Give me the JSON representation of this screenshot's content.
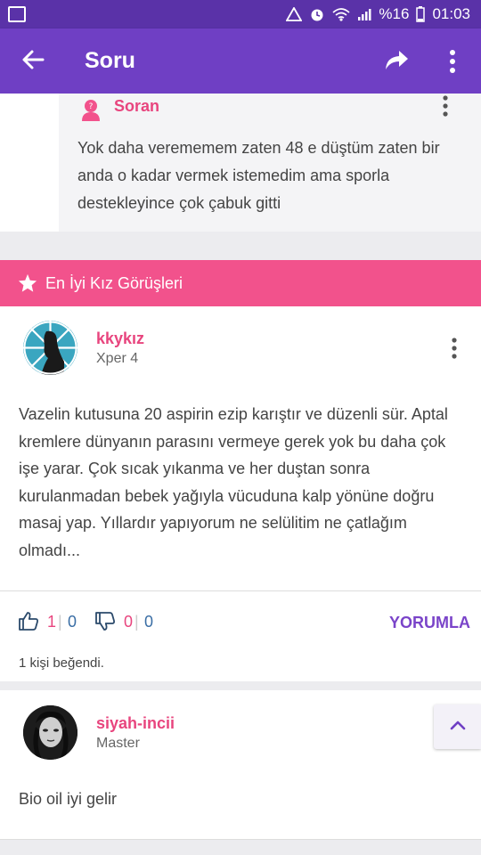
{
  "status_bar": {
    "battery_text": "%16",
    "time": "01:03"
  },
  "app_bar": {
    "title": "Soru",
    "back_icon": "arrow-left-icon",
    "share_icon": "share-icon",
    "more_icon": "more-vertical-icon"
  },
  "question": {
    "author_label": "Soran",
    "text": "Yok daha verememem zaten 48 e düştüm zaten bir anda o kadar vermek istemedim ama sporla destekleyince çok çabuk gitti"
  },
  "best_section": {
    "label": "En İyi Kız Görüşleri"
  },
  "answers": [
    {
      "username": "kkykız",
      "level": "Xper 4",
      "text": "Vazelin kutusuna 20 aspirin ezip karıştır ve düzenli sür. Aptal kremlere dünyanın parasını vermeye gerek yok bu daha çok işe yarar. Çok sıcak yıkanma ve her duştan sonra kurulanmadan bebek yağıyla vücuduna kalp yönüne doğru masaj yap. Yıllardır yapıyorum ne selülitim ne çatlağım olmadı...",
      "likes": "1",
      "likes_neutral": "0",
      "dislikes": "0",
      "dislikes_neutral": "0",
      "comment_label": "YORUMLA",
      "liked_by": "1 kişi beğendi."
    },
    {
      "username": "siyah-incii",
      "level": "Master",
      "text": "Bio oil iyi gelir"
    }
  ],
  "colors": {
    "status_bar": "#5a32a8",
    "app_bar": "#6f3fc4",
    "accent_pink": "#f2528c",
    "username_pink": "#e8457e",
    "comment_purple": "#7a44c9"
  }
}
